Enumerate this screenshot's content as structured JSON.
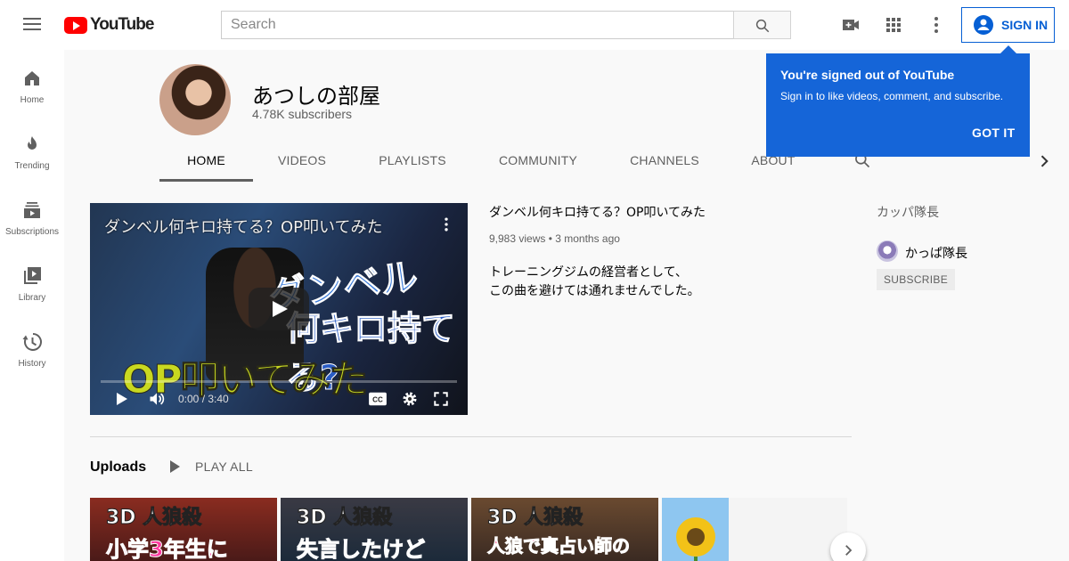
{
  "topbar": {
    "logo_text": "YouTube",
    "search_placeholder": "Search",
    "signin_label": "SIGN IN"
  },
  "sidebar": {
    "items": [
      {
        "label": "Home",
        "icon": "home-icon"
      },
      {
        "label": "Trending",
        "icon": "flame-icon"
      },
      {
        "label": "Subscriptions",
        "icon": "subscriptions-icon"
      },
      {
        "label": "Library",
        "icon": "library-icon"
      },
      {
        "label": "History",
        "icon": "history-icon"
      }
    ]
  },
  "channel": {
    "name": "あつしの部屋",
    "subscribers": "4.78K subscribers",
    "tabs": [
      "HOME",
      "VIDEOS",
      "PLAYLISTS",
      "COMMUNITY",
      "CHANNELS",
      "ABOUT"
    ],
    "active_tab": "HOME"
  },
  "tooltip": {
    "title": "You're signed out of YouTube",
    "body": "Sign in to like videos, comment, and subscribe.",
    "action": "GOT IT"
  },
  "featured": {
    "player_title": "ダンベル何キロ持てる？OP叩いてみた",
    "thumb_text_1": "ダンベル",
    "thumb_text_2": "何キロ持てる?",
    "thumb_text_3": "OP叩いてみた",
    "time": "0:00 / 3:40",
    "title": "ダンベル何キロ持てる？OP叩いてみた",
    "meta": "9,983 views • 3 months ago",
    "desc_line1": "トレーニングジムの経営者として、",
    "desc_line2": "この曲を避けては通れませんでした。"
  },
  "featured_channels": {
    "heading": "カッパ隊長",
    "items": [
      {
        "name": "かっぱ隊長",
        "action": "SUBSCRIBE"
      }
    ]
  },
  "uploads": {
    "title": "Uploads",
    "play_all": "PLAY ALL",
    "thumbs": [
      {
        "line1": "3D 人狼殺",
        "line2": "小学3年生に",
        "bg": "#7a2a22"
      },
      {
        "line1": "3D 人狼殺",
        "line2": "失言したけど",
        "bg": "#3a3a40"
      },
      {
        "line1": "3D 人狼殺",
        "line2": "人狼で真占い師の",
        "bg": "#5a3a28"
      },
      {
        "line1": "",
        "line2": "",
        "bg": "#8ec6f0"
      }
    ]
  },
  "colors": {
    "brand_red": "#ff0000",
    "accent_blue": "#065fd4",
    "tooltip_blue": "#1565d8"
  }
}
